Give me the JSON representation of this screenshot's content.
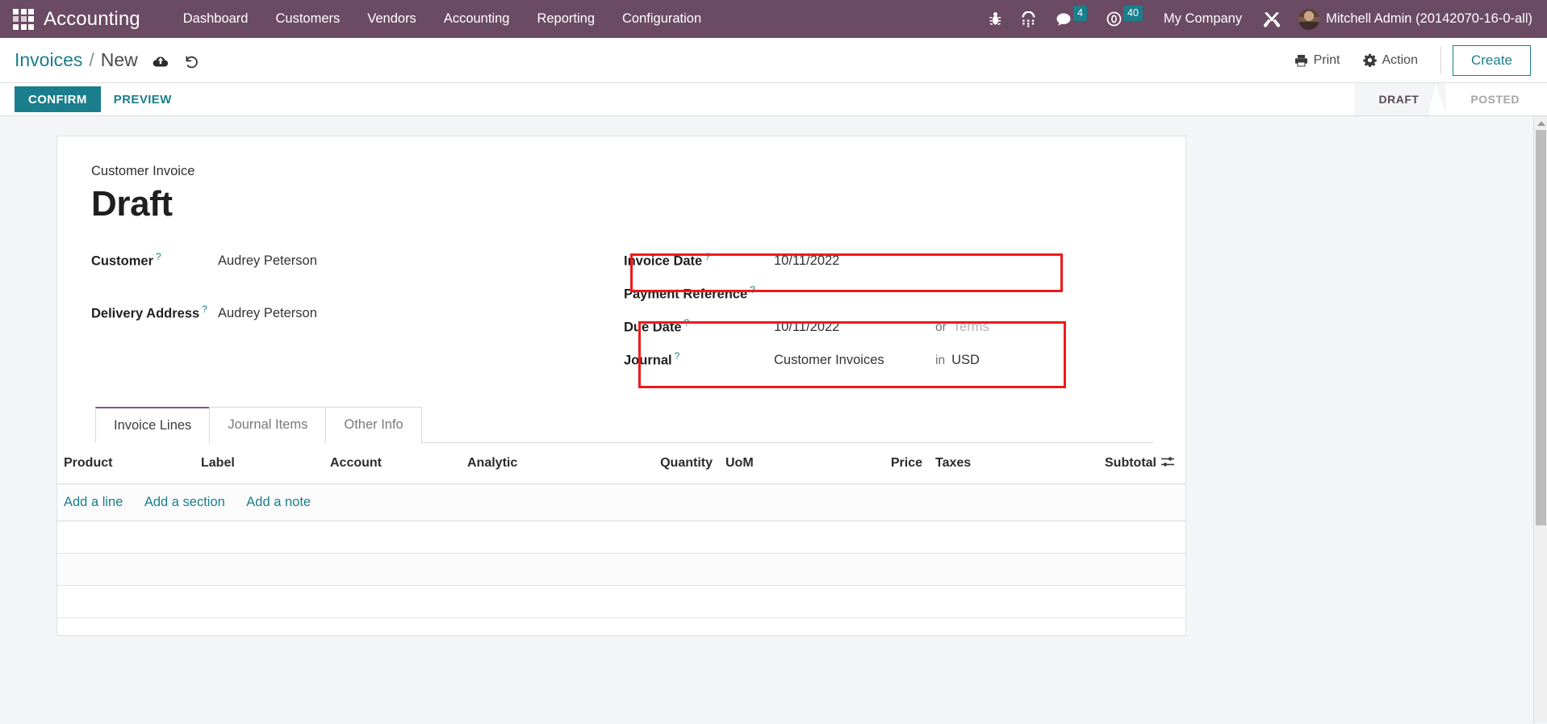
{
  "navbar": {
    "apps_icon": "apps-grid-icon",
    "brand": "Accounting",
    "menu": [
      {
        "label": "Dashboard"
      },
      {
        "label": "Customers"
      },
      {
        "label": "Vendors"
      },
      {
        "label": "Accounting"
      },
      {
        "label": "Reporting"
      },
      {
        "label": "Configuration"
      }
    ],
    "sys_icons": [
      {
        "name": "bug-icon"
      },
      {
        "name": "phone-keypad-icon"
      },
      {
        "name": "chat-bubble-icon",
        "badge": "4"
      },
      {
        "name": "clock-activity-icon",
        "badge": "40"
      }
    ],
    "company": "My Company",
    "tools_icon": "tools-wrench-icon",
    "avatar": "user-avatar",
    "user": "Mitchell Admin (20142070-16-0-all)",
    "bg_color": "#6b4a63",
    "badge_color": "#1a7e8c"
  },
  "control_panel": {
    "breadcrumb_parent": "Invoices",
    "breadcrumb_separator": "/",
    "breadcrumb_current": "New",
    "save_icon": "cloud-save-icon",
    "discard_icon": "undo-discard-icon",
    "print_label": "Print",
    "print_icon": "printer-icon",
    "action_label": "Action",
    "action_icon": "gear-icon",
    "create_label": "Create",
    "accent_color": "#1a7e8c"
  },
  "action_bar": {
    "confirm_label": "CONFIRM",
    "preview_label": "PREVIEW",
    "status_steps": [
      {
        "label": "DRAFT",
        "active": true
      },
      {
        "label": "POSTED",
        "active": false
      }
    ]
  },
  "form": {
    "doc_subtitle": "Customer Invoice",
    "doc_title": "Draft",
    "left_fields": [
      {
        "label": "Customer",
        "help": "?",
        "value": "Audrey Peterson"
      },
      {
        "label": "Delivery Address",
        "help": "?",
        "value": "Audrey Peterson"
      }
    ],
    "right_fields": [
      {
        "label": "Invoice Date",
        "help": "?",
        "value": "10/11/2022"
      },
      {
        "label": "Payment Reference",
        "help": "?",
        "value": ""
      },
      {
        "label": "Due Date",
        "help": "?",
        "value": "10/11/2022",
        "connector": "or",
        "extra_value": "Terms",
        "extra_is_placeholder": true
      },
      {
        "label": "Journal",
        "help": "?",
        "value": "Customer Invoices",
        "connector": "in",
        "extra_value": "USD",
        "extra_is_placeholder": false
      }
    ],
    "highlight_color": "#ef1a1a"
  },
  "tabs": [
    {
      "label": "Invoice Lines",
      "active": true
    },
    {
      "label": "Journal Items",
      "active": false
    },
    {
      "label": "Other Info",
      "active": false
    }
  ],
  "lines_table": {
    "columns": [
      "Product",
      "Label",
      "Account",
      "Analytic",
      "Quantity",
      "UoM",
      "Price",
      "Taxes",
      "Subtotal"
    ],
    "optional_columns_icon": "column-options-icon",
    "rows": [],
    "add_links": [
      "Add a line",
      "Add a section",
      "Add a note"
    ]
  },
  "scrollbar": {
    "up_arrow_icon": "scroll-up-arrow-icon",
    "thumb": "scroll-thumb"
  }
}
